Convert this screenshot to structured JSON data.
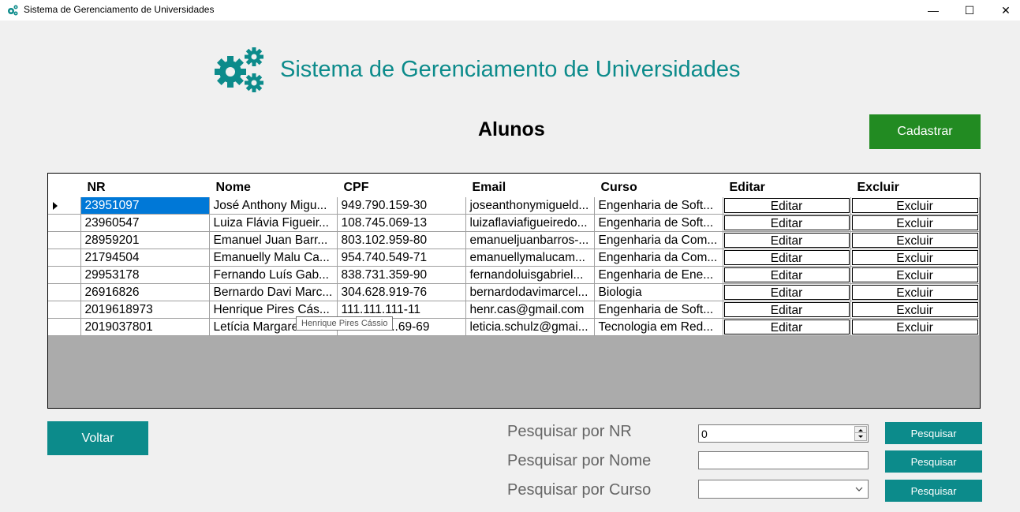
{
  "window": {
    "title": "Sistema de Gerenciamento de Universidades",
    "minimize": "—",
    "maximize": "☐",
    "close": "✕"
  },
  "header": {
    "title": "Sistema de Gerenciamento de Universidades",
    "logo_icon": "gears-icon",
    "accent_color": "#0c8b8b"
  },
  "page": {
    "title": "Alunos",
    "cadastrar_label": "Cadastrar",
    "voltar_label": "Voltar"
  },
  "grid": {
    "columns": [
      "NR",
      "Nome",
      "CPF",
      "Email",
      "Curso",
      "Editar",
      "Excluir"
    ],
    "rows": [
      {
        "nr": "23951097",
        "nome": "José Anthony Migu...",
        "cpf": "949.790.159-30",
        "email": "joseanthonymigueld...",
        "curso": "Engenharia de Soft...",
        "editar": "Editar",
        "excluir": "Excluir"
      },
      {
        "nr": "23960547",
        "nome": "Luiza Flávia Figueir...",
        "cpf": "108.745.069-13",
        "email": "luizaflaviafigueiredo...",
        "curso": "Engenharia de Soft...",
        "editar": "Editar",
        "excluir": "Excluir"
      },
      {
        "nr": "28959201",
        "nome": "Emanuel Juan Barr...",
        "cpf": "803.102.959-80",
        "email": "emanueljuanbarros-...",
        "curso": "Engenharia da Com...",
        "editar": "Editar",
        "excluir": "Excluir"
      },
      {
        "nr": "21794504",
        "nome": "Emanuelly Malu Ca...",
        "cpf": "954.740.549-71",
        "email": "emanuellymalucam...",
        "curso": "Engenharia da Com...",
        "editar": "Editar",
        "excluir": "Excluir"
      },
      {
        "nr": "29953178",
        "nome": "Fernando Luís Gab...",
        "cpf": "838.731.359-90",
        "email": "fernandoluisgabriel...",
        "curso": "Engenharia de Ene...",
        "editar": "Editar",
        "excluir": "Excluir"
      },
      {
        "nr": "26916826",
        "nome": "Bernardo Davi Marc...",
        "cpf": "304.628.919-76",
        "email": "bernardodavimarcel...",
        "curso": "Biologia",
        "editar": "Editar",
        "excluir": "Excluir"
      },
      {
        "nr": "2019618973",
        "nome": "Henrique Pires Cás...",
        "cpf": "111.111.111-11",
        "email": "henr.cas@gmail.com",
        "curso": "Engenharia de Soft...",
        "editar": "Editar",
        "excluir": "Excluir"
      },
      {
        "nr": "2019037801",
        "nome": "Letícia Margare...",
        "cpf": "...69-69",
        "email": "leticia.schulz@gmai...",
        "curso": "Tecnologia em Red...",
        "editar": "Editar",
        "excluir": "Excluir"
      }
    ],
    "selected_row": 0,
    "tooltip": "Henrique Pires Cássio"
  },
  "search": {
    "nr_label": "Pesquisar por NR",
    "nr_value": "0",
    "nome_label": "Pesquisar por Nome",
    "nome_value": "",
    "curso_label": "Pesquisar por Curso",
    "curso_value": "",
    "button_label": "Pesquisar"
  }
}
